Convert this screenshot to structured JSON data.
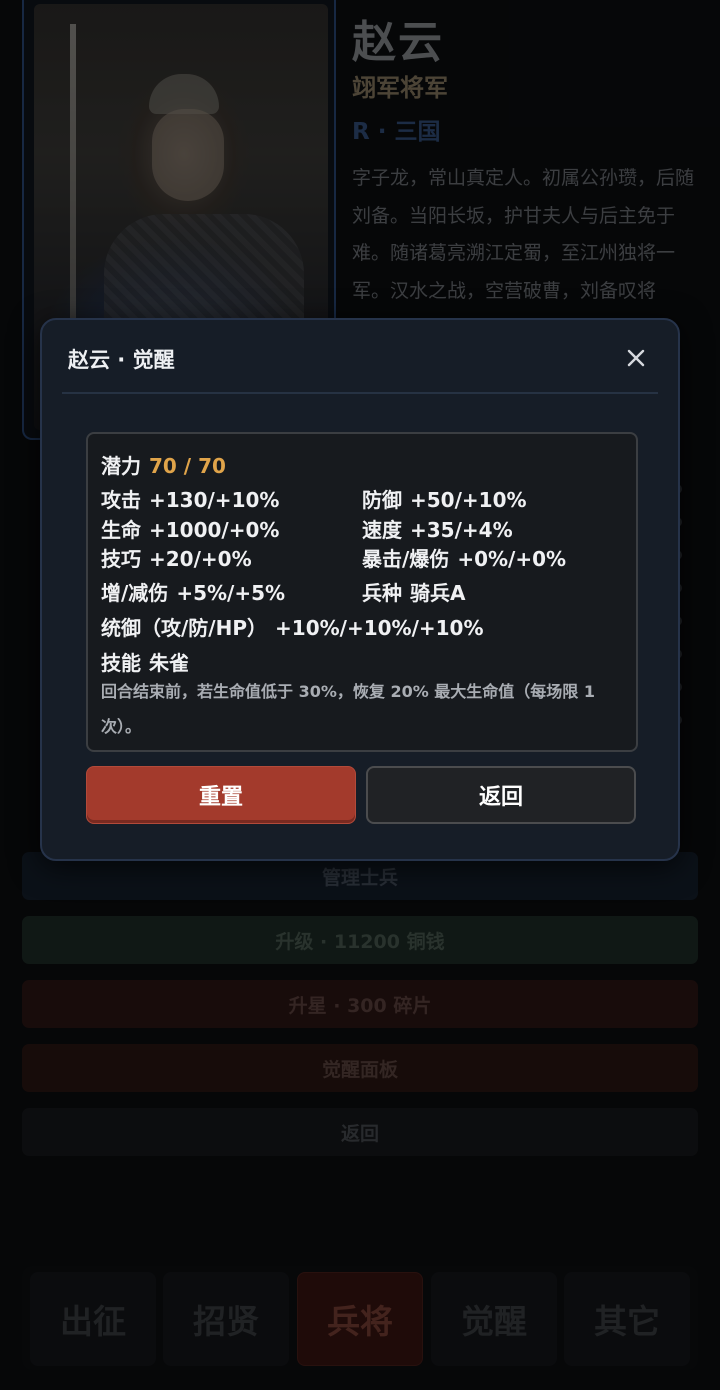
{
  "hero": {
    "name": "赵云",
    "title": "翊军将军",
    "rarity": "R · 三国",
    "bio": "字子龙，常山真定人。初属公孙瓒，后随刘备。当阳长坂，护甘夫人与后主免于难。随诸葛亮溯江定蜀，至江州独将一军。汉水之战，空营破曹，刘备叹将"
  },
  "actions": {
    "manage_soldiers": "管理士兵",
    "level_up": "升级 · 11200 铜钱",
    "star_up": "升星 · 300 碎片",
    "awaken_panel": "觉醒面板",
    "back": "返回"
  },
  "nav": {
    "items": [
      {
        "label": "出征",
        "active": false
      },
      {
        "label": "招贤",
        "active": false
      },
      {
        "label": "兵将",
        "active": true
      },
      {
        "label": "觉醒",
        "active": false
      },
      {
        "label": "其它",
        "active": false
      }
    ]
  },
  "modal": {
    "title": "赵云 · 觉醒",
    "close_icon": "close-icon",
    "potential_label": "潜力",
    "potential_value": "70 / 70",
    "stats": {
      "attack_label": "攻击",
      "attack_value": "+130/+10%",
      "defense_label": "防御",
      "defense_value": "+50/+10%",
      "hp_label": "生命",
      "hp_value": "+1000/+0%",
      "speed_label": "速度",
      "speed_value": "+35/+4%",
      "skill_label": "技巧",
      "skill_value": "+20/+0%",
      "crit_label": "暴击/爆伤",
      "crit_value": "+0%/+0%",
      "dmg_label": "增/减伤",
      "dmg_value": "+5%/+5%",
      "troop_label": "兵种",
      "troop_value": "骑兵A",
      "command_label": "统御（攻/防/HP）",
      "command_value": "+10%/+10%/+10%",
      "ability_label": "技能",
      "ability_value": "朱雀"
    },
    "skill_desc": "回合结束前，若生命值低于 30%，恢复 20% 最大生命值（每场限 1 次）。",
    "reset_label": "重置",
    "return_label": "返回"
  },
  "colors": {
    "accent_gold": "#e0a44a",
    "reset_red": "#a33a2c",
    "modal_bg": "#161d27"
  }
}
